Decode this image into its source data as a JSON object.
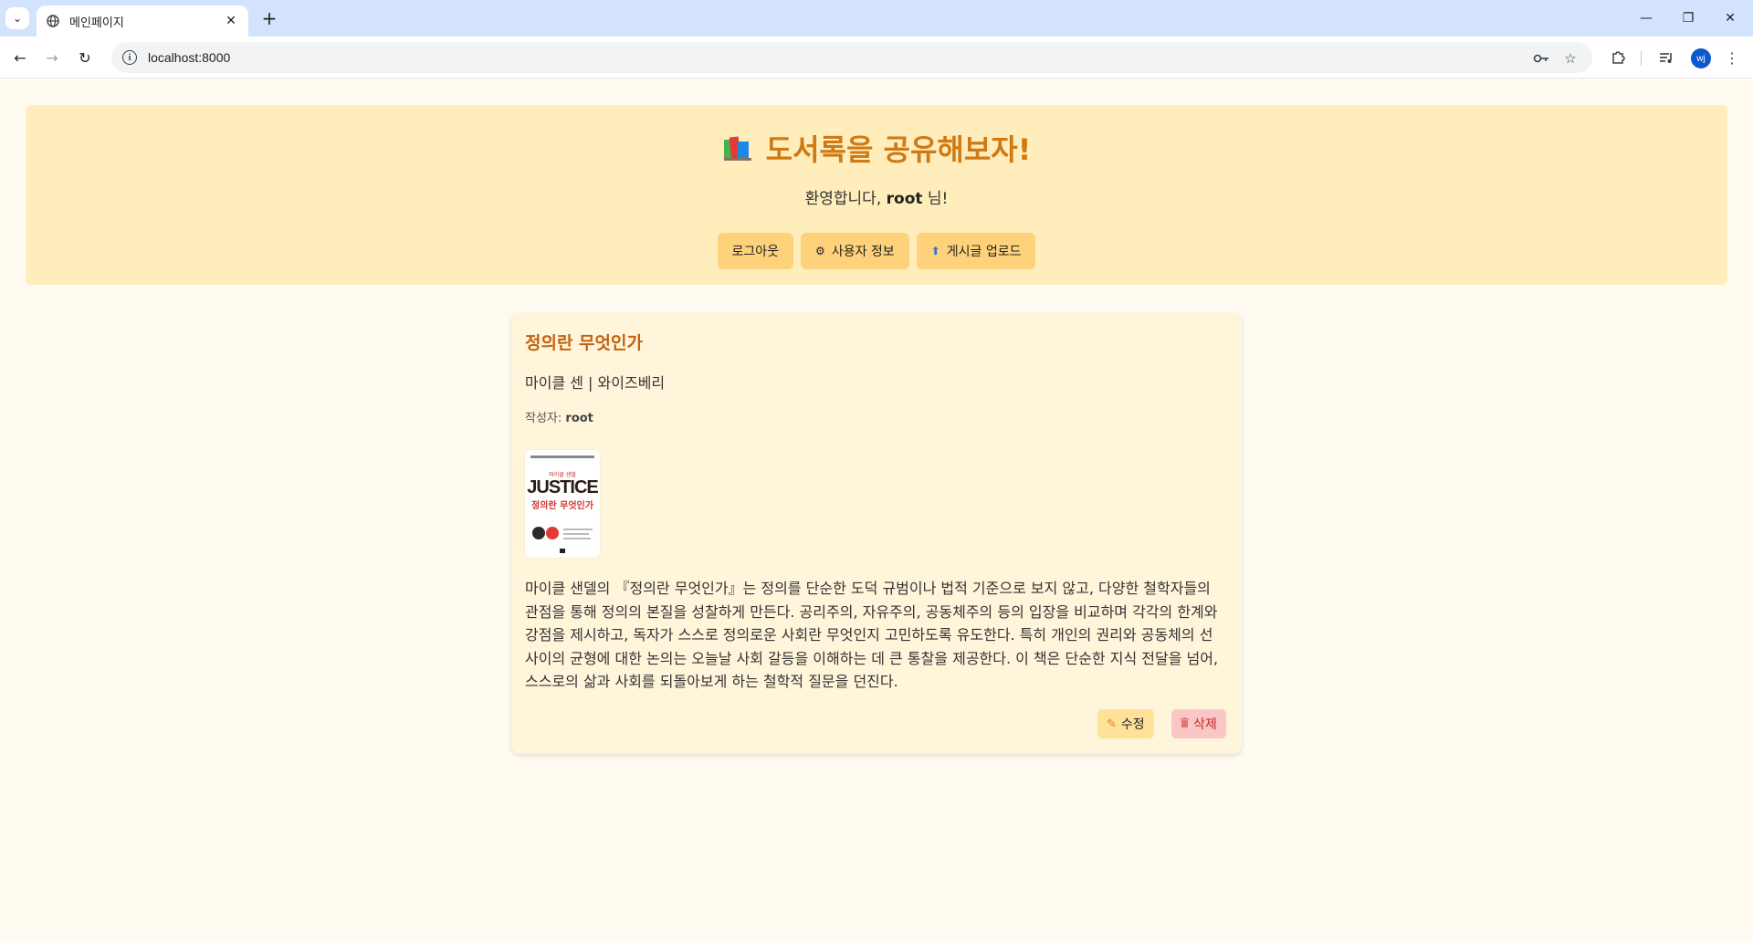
{
  "browser": {
    "tab_title": "메인페이지",
    "url": "localhost:8000",
    "avatar_initials": "wj"
  },
  "header": {
    "title": "도서록을 공유해보자!",
    "welcome_prefix": "환영합니다, ",
    "username": "root",
    "welcome_suffix": " 님!",
    "buttons": {
      "logout": "로그아웃",
      "user_info": "사용자 정보",
      "upload": "게시글 업로드"
    }
  },
  "post": {
    "title": "정의란 무엇인가",
    "meta": "마이클 센 | 와이즈베리",
    "author_label": "작성자: ",
    "author": "root",
    "cover": {
      "top_line": "마이클 샌델",
      "title_en": "JUSTICE",
      "title_kr": "정의란 무엇인가"
    },
    "description": "마이클 샌델의 『정의란 무엇인가』는 정의를 단순한 도덕 규범이나 법적 기준으로 보지 않고, 다양한 철학자들의 관점을 통해 정의의 본질을 성찰하게 만든다. 공리주의, 자유주의, 공동체주의 등의 입장을 비교하며 각각의 한계와 강점을 제시하고, 독자가 스스로 정의로운 사회란 무엇인지 고민하도록 유도한다. 특히 개인의 권리와 공동체의 선 사이의 균형에 대한 논의는 오늘날 사회 갈등을 이해하는 데 큰 통찰을 제공한다. 이 책은 단순한 지식 전달을 넘어, 스스로의 삶과 사회를 되돌아보게 하는 철학적 질문을 던진다.",
    "edit_label": "수정",
    "delete_label": "삭제"
  },
  "colors": {
    "header_bg": "#ffedbc",
    "title_color": "#cf7a14",
    "button_bg": "#fed27a",
    "card_bg": "#fff5da",
    "post_title_color": "#c2620f",
    "delete_bg": "#fbc6c6"
  }
}
